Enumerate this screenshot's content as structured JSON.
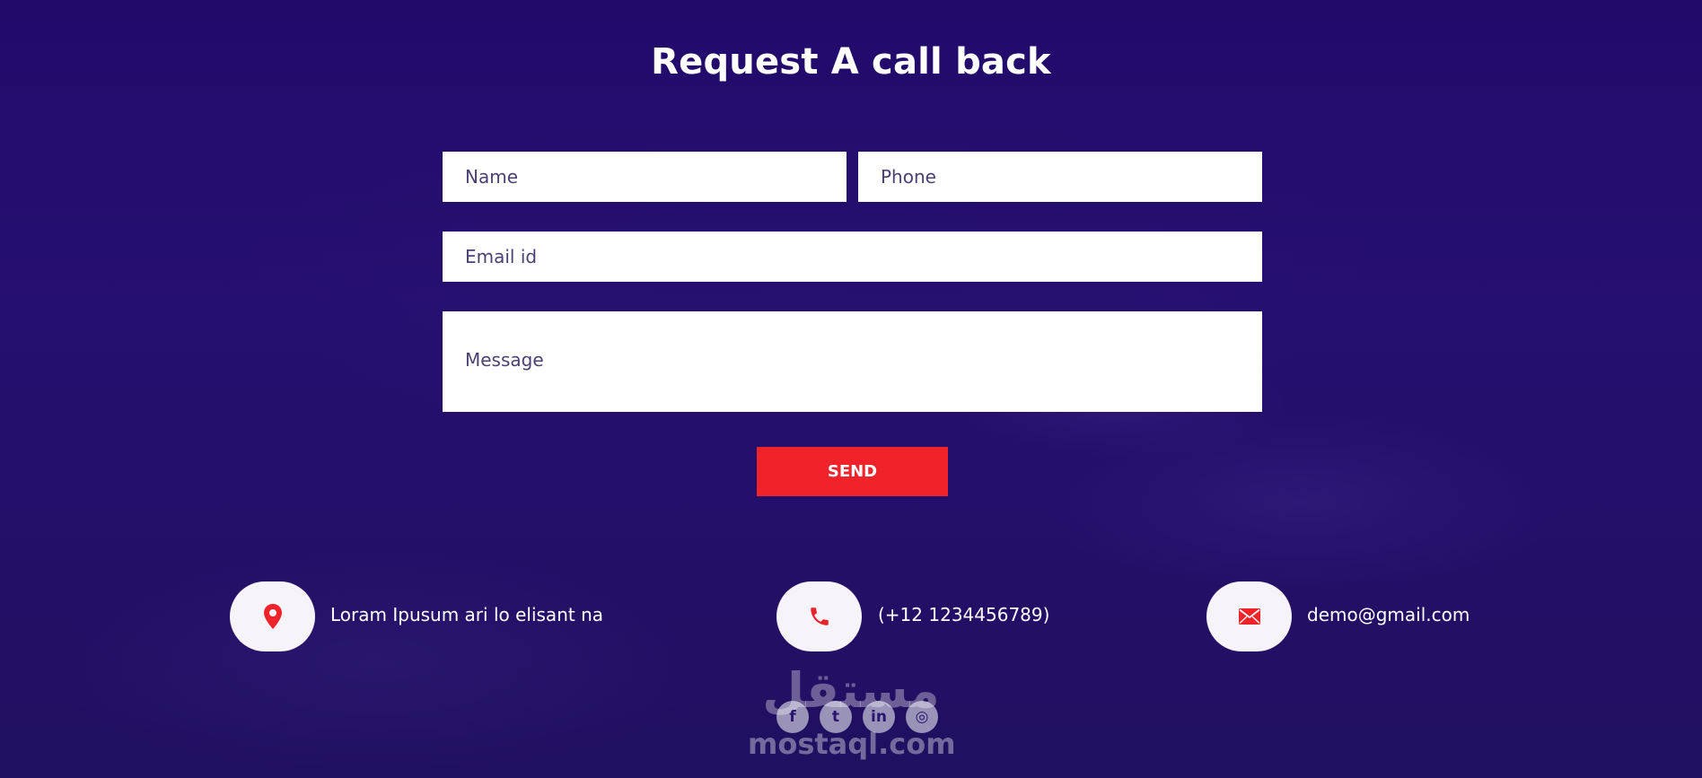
{
  "title": "Request A call back",
  "form": {
    "name_placeholder": "Name",
    "phone_placeholder": "Phone",
    "email_placeholder": "Email id",
    "message_placeholder": "Message",
    "send_label": "SEND"
  },
  "contact": {
    "address": "Loram Ipusum ari lo elisant na",
    "phone": "(+12 1234456789)",
    "email": "demo@gmail.com",
    "icons": [
      "location-pin-icon",
      "phone-icon",
      "mail-icon"
    ]
  },
  "socials": [
    {
      "icon": "facebook-icon",
      "glyph": "f"
    },
    {
      "icon": "twitter-icon",
      "glyph": "t"
    },
    {
      "icon": "linkedin-icon",
      "glyph": "in"
    },
    {
      "icon": "instagram-icon",
      "glyph": "◎"
    }
  ],
  "watermark": {
    "arabic": "مستقل",
    "latin": "mostaql.com"
  },
  "colors": {
    "background": "#230c6a",
    "accent": "#f0232b",
    "field_bg": "#ffffff",
    "icon_bg": "#f6f4f8"
  }
}
